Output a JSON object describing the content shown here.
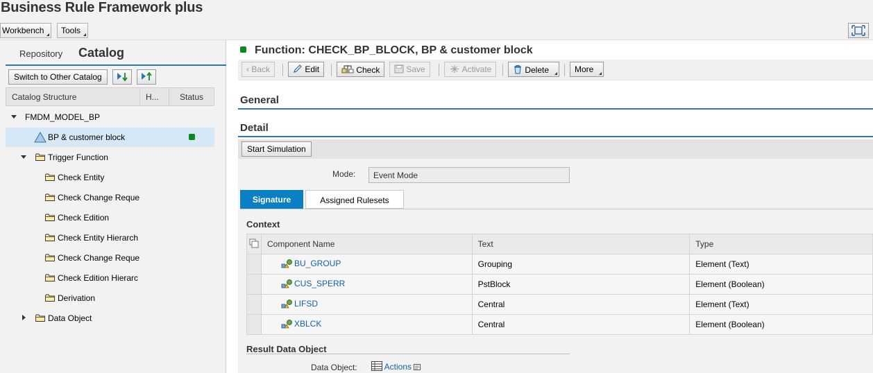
{
  "app": {
    "title": "Business Rule Framework plus"
  },
  "menu": {
    "workbench": "Workbench",
    "tools": "Tools"
  },
  "left": {
    "tabs": {
      "repository": "Repository",
      "catalog": "Catalog"
    },
    "toolbar": {
      "switch_catalog": "Switch to Other Catalog"
    },
    "columns": {
      "structure": "Catalog Structure",
      "h": "H...",
      "status": "Status"
    },
    "tree": [
      {
        "label": "FMDM_MODEL_BP",
        "expanded": true
      },
      {
        "label": "BP & customer block",
        "selected": true,
        "status": "active"
      },
      {
        "label": "Trigger Function",
        "expanded": true
      },
      {
        "label": "Check Entity"
      },
      {
        "label": "Check Change Reque"
      },
      {
        "label": "Check Edition"
      },
      {
        "label": "Check Entity Hierarch"
      },
      {
        "label": "Check Change Reque"
      },
      {
        "label": "Check Edition Hierarc"
      },
      {
        "label": "Derivation"
      },
      {
        "label": "Data Object",
        "expanded": false
      }
    ]
  },
  "right": {
    "function_title": "Function: CHECK_BP_BLOCK, BP & customer block",
    "toolbar": {
      "back": "Back",
      "edit": "Edit",
      "check": "Check",
      "save": "Save",
      "activate": "Activate",
      "delete": "Delete",
      "more": "More"
    },
    "sections": {
      "general": "General",
      "detail": "Detail"
    },
    "start_simulation": "Start Simulation",
    "mode": {
      "label": "Mode:",
      "value": "Event Mode"
    },
    "sub_tabs": {
      "signature": "Signature",
      "assigned": "Assigned Rulesets"
    },
    "context": {
      "heading": "Context",
      "columns": [
        "Component Name",
        "Text",
        "Type"
      ],
      "rows": [
        {
          "name": "BU_GROUP",
          "text": "Grouping",
          "type": "Element (Text)"
        },
        {
          "name": "CUS_SPERR",
          "text": "PstBlock",
          "type": "Element (Boolean)"
        },
        {
          "name": "LIFSD",
          "text": "Central",
          "type": "Element (Text)"
        },
        {
          "name": "XBLCK",
          "text": "Central",
          "type": "Element (Boolean)"
        }
      ]
    },
    "result": {
      "heading": "Result Data Object",
      "label": "Data Object:",
      "value": "Actions"
    }
  },
  "colors": {
    "accent": "#2b78b0",
    "active_tab": "#0a7fc2",
    "status_green": "#0a8a1e",
    "link": "#1060a8"
  }
}
